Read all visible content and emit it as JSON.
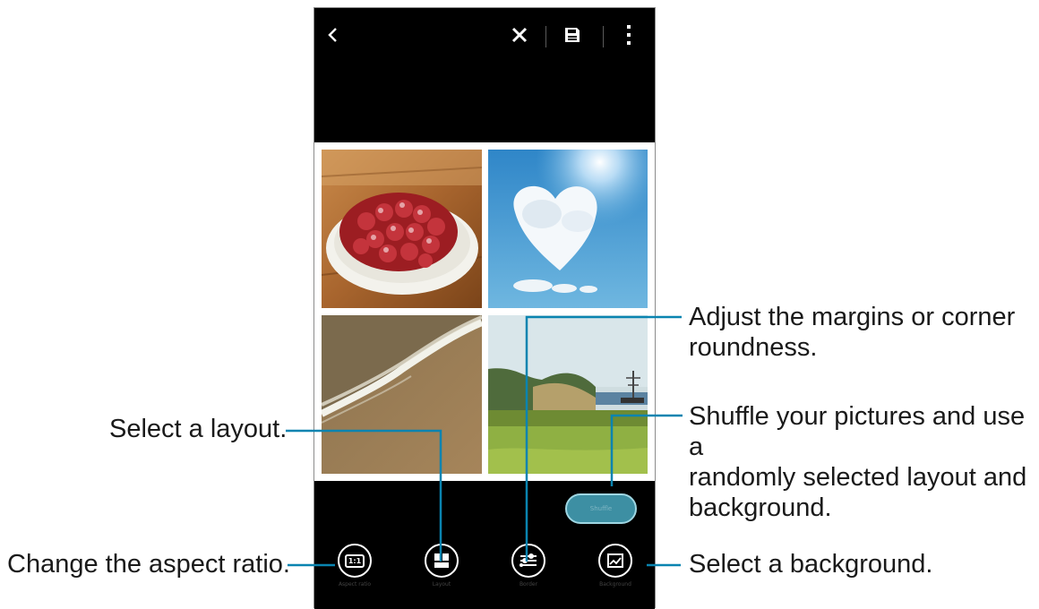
{
  "toolbar": {
    "back_icon": "chevron-left-icon",
    "discard_icon": "close-icon",
    "save_icon": "save-icon",
    "more_icon": "more-vert-icon"
  },
  "collage": {
    "photos": [
      "strawberry-tart-icon",
      "heart-cloud-sky-icon",
      "beach-wave-sand-icon",
      "grassland-ship-icon"
    ]
  },
  "bottom": {
    "shuffle_label": "Shuffle",
    "tools": [
      {
        "label": "Aspect ratio",
        "glyph": "1:1",
        "icon": "aspect-ratio-icon"
      },
      {
        "label": "Layout",
        "icon": "layout-icon"
      },
      {
        "label": "Border",
        "icon": "border-icon"
      },
      {
        "label": "Background",
        "icon": "background-icon"
      }
    ]
  },
  "callouts": {
    "layout": "Select a layout.",
    "aspect": "Change the aspect ratio.",
    "margins_line1": "Adjust the margins or corner",
    "margins_line2": "roundness.",
    "shuffle_line1": "Shuffle your pictures and use a",
    "shuffle_line2": "randomly selected layout and",
    "shuffle_line3": "background.",
    "background": "Select a background."
  },
  "colors": {
    "accent": "#0a84b0",
    "phone_bg": "#000000",
    "shuffle_button": "#3d8fa3"
  }
}
